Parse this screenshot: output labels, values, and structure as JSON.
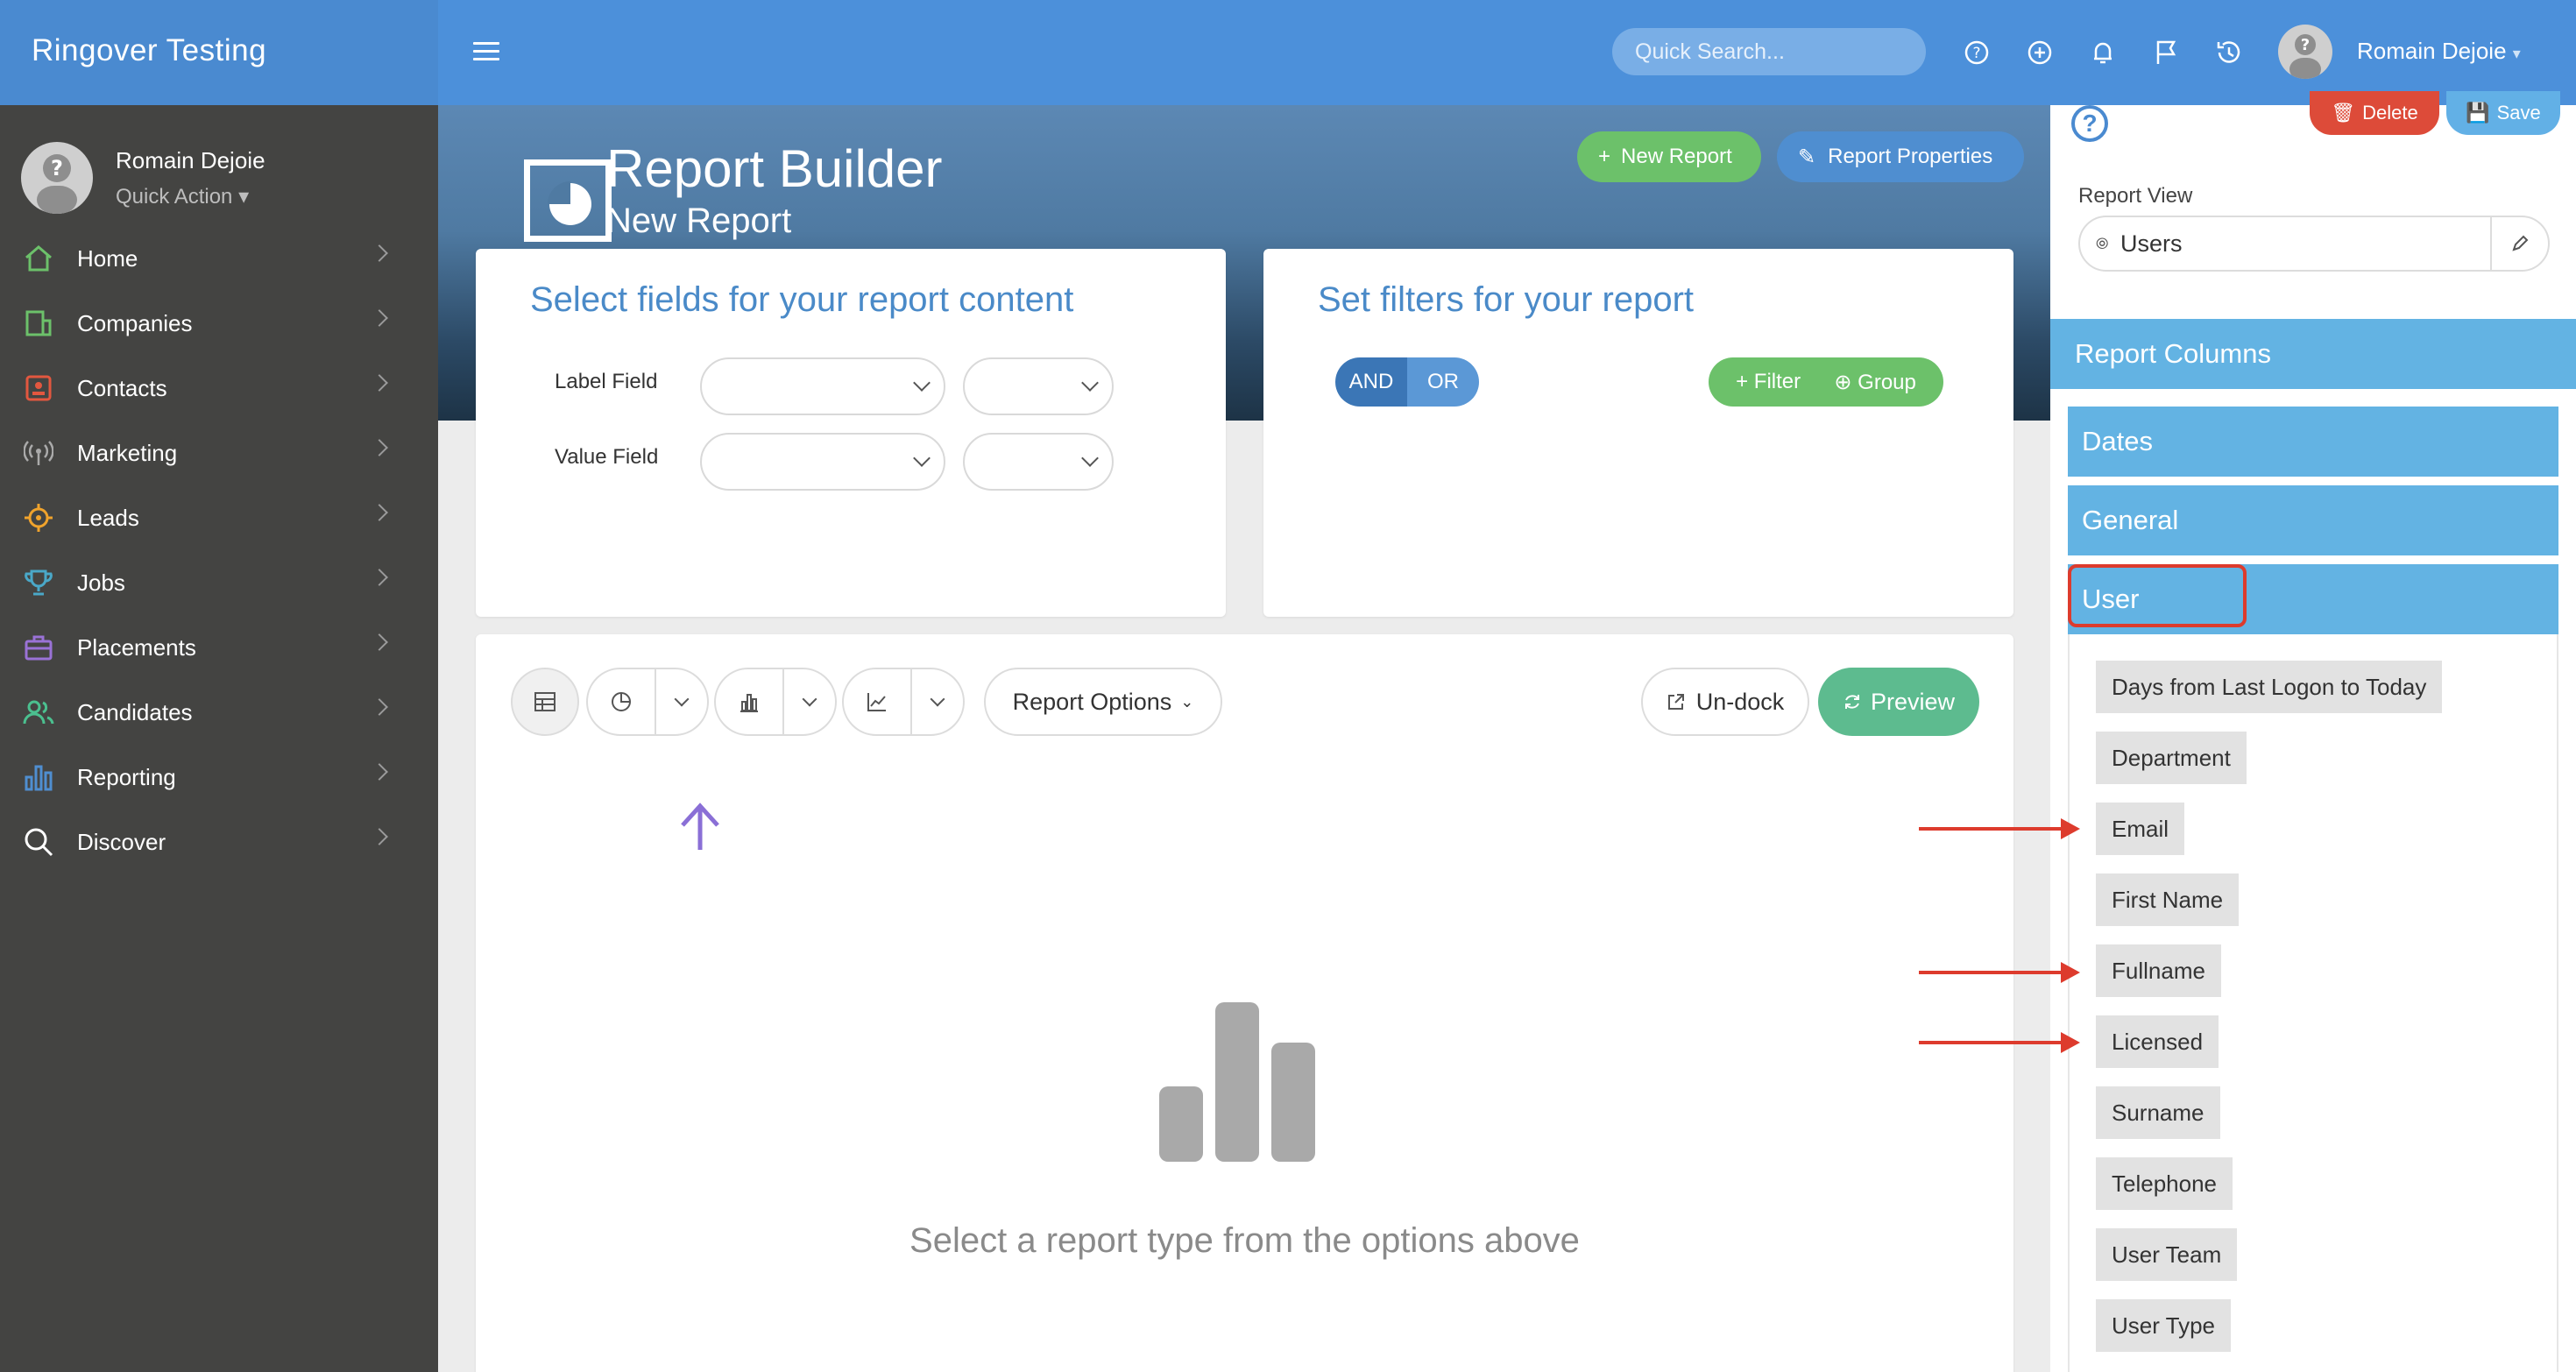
{
  "app": {
    "brand": "Ringover Testing"
  },
  "sidebar": {
    "user_name": "Romain Dejoie",
    "quick_action": "Quick Action",
    "items": [
      {
        "label": "Home",
        "icon": "home-icon"
      },
      {
        "label": "Companies",
        "icon": "building-icon"
      },
      {
        "label": "Contacts",
        "icon": "contact-card-icon"
      },
      {
        "label": "Marketing",
        "icon": "broadcast-icon"
      },
      {
        "label": "Leads",
        "icon": "target-icon"
      },
      {
        "label": "Jobs",
        "icon": "trophy-icon"
      },
      {
        "label": "Placements",
        "icon": "briefcase-icon"
      },
      {
        "label": "Candidates",
        "icon": "people-icon"
      },
      {
        "label": "Reporting",
        "icon": "bar-chart-icon"
      },
      {
        "label": "Discover",
        "icon": "search-icon"
      }
    ]
  },
  "topbar": {
    "search_placeholder": "Quick Search...",
    "user_name": "Romain Dejoie",
    "icons": [
      "help-icon",
      "plus-circle-icon",
      "bell-icon",
      "flag-icon",
      "history-icon"
    ]
  },
  "hero": {
    "title": "Report Builder",
    "subtitle": "New Report",
    "new_report": "New Report",
    "report_properties": "Report Properties"
  },
  "fields_card": {
    "title": "Select fields for your report content",
    "label_field": "Label Field",
    "value_field": "Value Field"
  },
  "filters_card": {
    "title": "Set filters for your report",
    "and": "AND",
    "or": "OR",
    "filter": "Filter",
    "group": "Group"
  },
  "main": {
    "report_options": "Report Options",
    "undock": "Un-dock",
    "preview": "Preview",
    "empty_message": "Select a report type from the options above"
  },
  "right_panel": {
    "delete": "Delete",
    "save": "Save",
    "report_view_label": "Report View",
    "report_view_value": "Users",
    "report_columns": "Report Columns",
    "groups": [
      "Dates",
      "General",
      "User"
    ],
    "user_columns": [
      "Days from Last Logon to Today",
      "Department",
      "Email",
      "First Name",
      "Fullname",
      "Licensed",
      "Surname",
      "Telephone",
      "User Team",
      "User Type"
    ]
  },
  "colors": {
    "accent": "#4c90da",
    "green": "#6cc16a",
    "danger": "#dd4b39",
    "columns_header": "#63b3e3"
  }
}
